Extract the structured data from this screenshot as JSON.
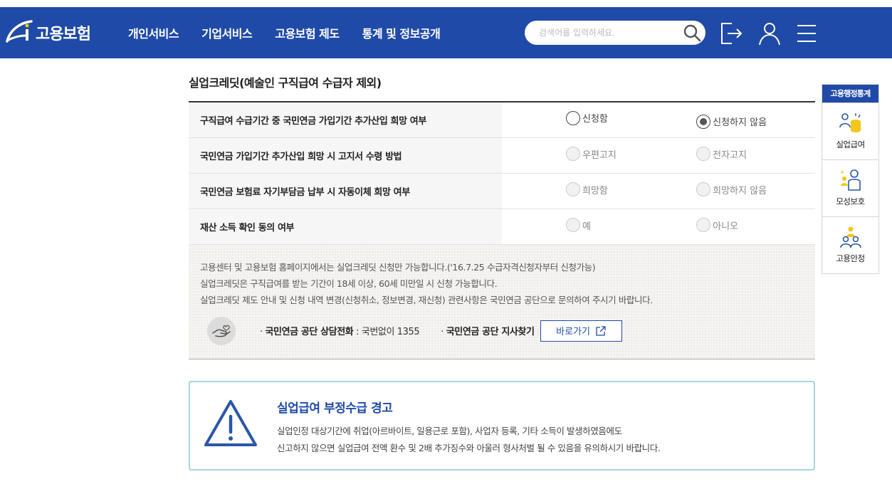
{
  "header": {
    "logo_text": "고용보험",
    "nav": [
      "개인서비스",
      "기업서비스",
      "고용보험 제도",
      "통계 및 정보공개"
    ],
    "search_placeholder": "검색어를 입력하세요."
  },
  "section": {
    "title": "실업크레딧(예술인 구직급여 수급자 제외)",
    "rows": [
      {
        "question": "구직급여 수급기간 중 국민연금 가입기간 추가산입 희망 여부",
        "opt1": "신청함",
        "opt2": "신청하지 않음"
      },
      {
        "question": "국민연금 가입기간 추가산입 희망 시 고지서 수령 방법",
        "opt1": "우편고지",
        "opt2": "전자고지"
      },
      {
        "question": "국민연금 보험료 자기부담금 납부 시 자동이체 희망 여부",
        "opt1": "희망함",
        "opt2": "희망하지 않음"
      },
      {
        "question": "재산 소득 확인 동의 여부",
        "opt1": "예",
        "opt2": "아니오"
      }
    ]
  },
  "notice": {
    "lines": [
      "고용센터 및 고용보험 홈페이지에서는 실업크레딧 신청만 가능합니다.('16.7.25 수급자격신청자부터 신청가능)",
      "실업크레딧은 구직급여를 받는 기간이 18세 이상, 60세 미만일 시 신청 가능합니다.",
      "실업크레딧 제도 안내 및 신청 내역 변경(신청취소, 정보변경, 재신청) 관련사항은 국민연금 공단으로 문의하여 주시기 바랍니다."
    ],
    "contact_label": "국민연금 공단 상담전화",
    "contact_value": " : 국번없이 1355",
    "branch_label": "국민연금 공단 지사찾기",
    "goto_label": "바로가기"
  },
  "warning": {
    "title": "실업급여 부정수급 경고",
    "line1": "실업인정 대상기간에 취업(아르바이트, 일용근로 포함), 사업자 등록, 기타 소득이 발생하였음에도",
    "line2": "신고하지 않으면 실업급여 전액 환수 및 2배 추가징수와 아울러 형사처벌 될 수 있음을 유의하시기 바랍니다."
  },
  "quick_menu": {
    "title": "고용행정통계",
    "items": [
      "실업급여",
      "모성보호",
      "고용안정"
    ]
  },
  "colors": {
    "primary": "#1f4aa8",
    "accent": "#f5c518",
    "warning_border": "#a9d3e3"
  }
}
